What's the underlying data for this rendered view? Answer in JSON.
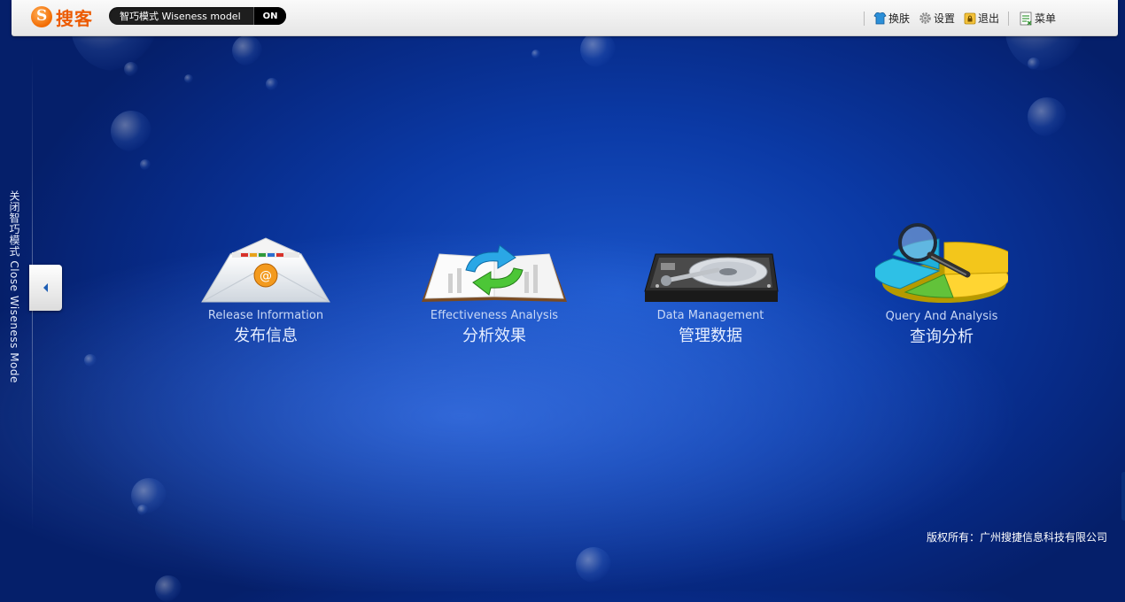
{
  "header": {
    "logo_text": "搜客",
    "mode_label": "智巧模式 Wiseness model",
    "mode_state": "ON",
    "actions": [
      {
        "label": "换肤",
        "icon": "skin-icon"
      },
      {
        "label": "设置",
        "icon": "gear-icon"
      },
      {
        "label": "退出",
        "icon": "lock-exit-icon"
      },
      {
        "label": "菜单",
        "icon": "menu-list-icon"
      }
    ]
  },
  "sidebar": {
    "close_label": "关闭智巧模式 Close Wiseness Mode"
  },
  "tiles": [
    {
      "en": "Release Information",
      "zh": "发布信息",
      "icon": "envelope-icon"
    },
    {
      "en": "Effectiveness Analysis",
      "zh": "分析效果",
      "icon": "book-refresh-icon"
    },
    {
      "en": "Data Management",
      "zh": "管理数据",
      "icon": "hard-drive-icon"
    },
    {
      "en": "Query And Analysis",
      "zh": "查询分析",
      "icon": "pie-magnifier-icon"
    }
  ],
  "footer": {
    "copyright": "版权所有：广州搜捷信息科技有限公司"
  },
  "colors": {
    "background": "#0b3aa6",
    "logo_orange": "#ec5a00",
    "toggle_dark": "#1e1e1e"
  }
}
